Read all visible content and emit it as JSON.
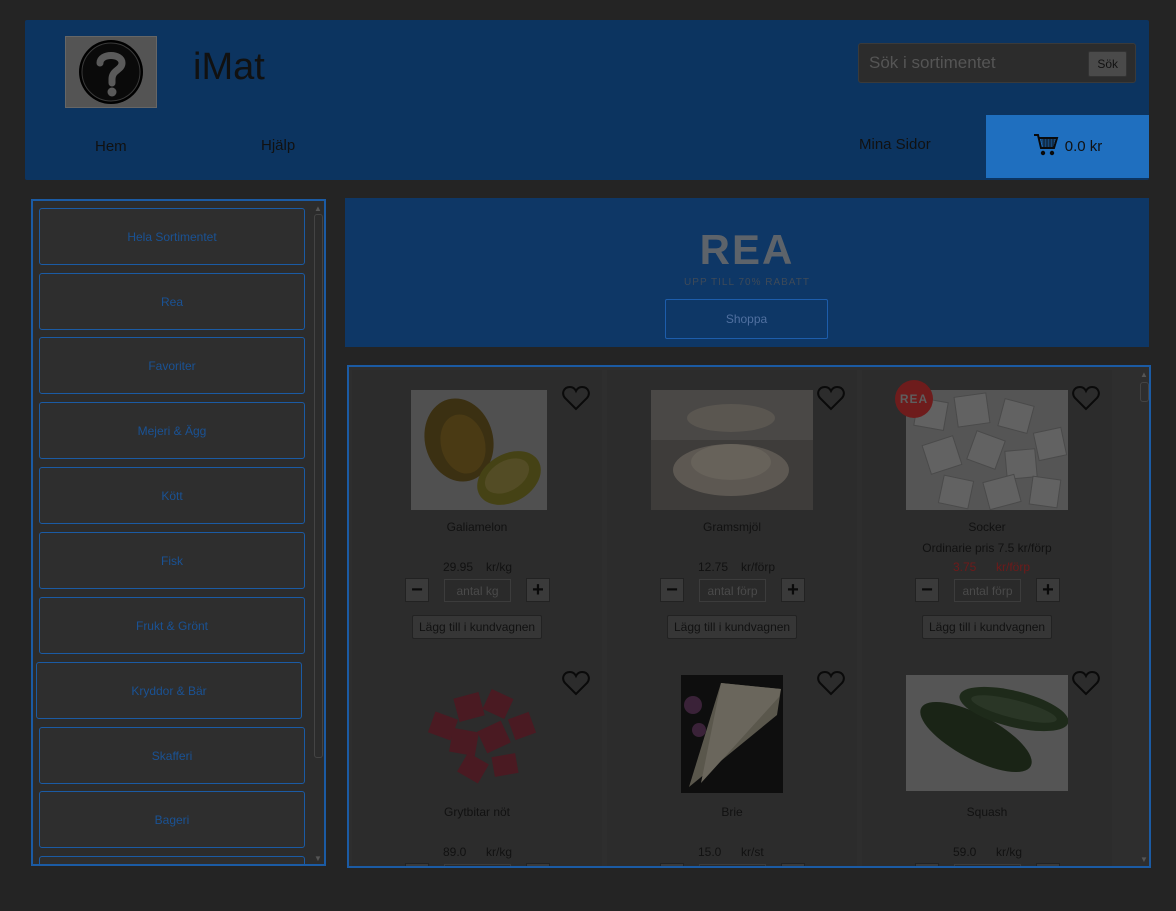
{
  "header": {
    "title": "iMat",
    "search_placeholder": "Sök i sortimentet",
    "search_button": "Sök",
    "nav": {
      "home": "Hem",
      "help": "Hjälp",
      "my_pages": "Mina Sidor"
    },
    "cart_total": "0.0 kr"
  },
  "sidebar": {
    "categories": [
      "Hela Sortimentet",
      "Rea",
      "Favoriter",
      "Mejeri & Ägg",
      "Kött",
      "Fisk",
      "Frukt & Grönt",
      "Kryddor & Bär",
      "Skafferi",
      "Bageri"
    ]
  },
  "banner": {
    "title": "REA",
    "subtitle": "UPP TILL 70% RABATT",
    "button": "Shoppa"
  },
  "products": [
    {
      "name": "Galiamelon",
      "ordinary": "",
      "price": "29.95",
      "unit": "kr/kg",
      "qty_placeholder": "antal kg",
      "add_label": "Lägg till i kundvagnen",
      "on_sale": false
    },
    {
      "name": "Gramsmjöl",
      "ordinary": "",
      "price": "12.75",
      "unit": "kr/förp",
      "qty_placeholder": "antal förp",
      "add_label": "Lägg till i kundvagnen",
      "on_sale": false
    },
    {
      "name": "Socker",
      "ordinary": "Ordinarie pris 7.5 kr/förp",
      "price": "3.75",
      "unit": "kr/förp",
      "qty_placeholder": "antal förp",
      "add_label": "Lägg till i kundvagnen",
      "on_sale": true,
      "badge": "REA"
    },
    {
      "name": "Grytbitar nöt",
      "ordinary": "",
      "price": "89.0",
      "unit": "kr/kg",
      "on_sale": false
    },
    {
      "name": "Brie",
      "ordinary": "",
      "price": "15.0",
      "unit": "kr/st",
      "on_sale": false
    },
    {
      "name": "Squash",
      "ordinary": "",
      "price": "59.0",
      "unit": "kr/kg",
      "on_sale": false
    }
  ],
  "icons": {
    "logo": "question-mark-logo",
    "cart": "shopping-cart-icon",
    "favorite": "heart-outline-icon",
    "minus": "minus-icon",
    "plus": "plus-icon"
  },
  "colors": {
    "header_bg": "#0c3460",
    "cart_bg": "#1f6fbf",
    "accent_border": "#1b5ba4",
    "sale_red": "#6e1a1a"
  }
}
